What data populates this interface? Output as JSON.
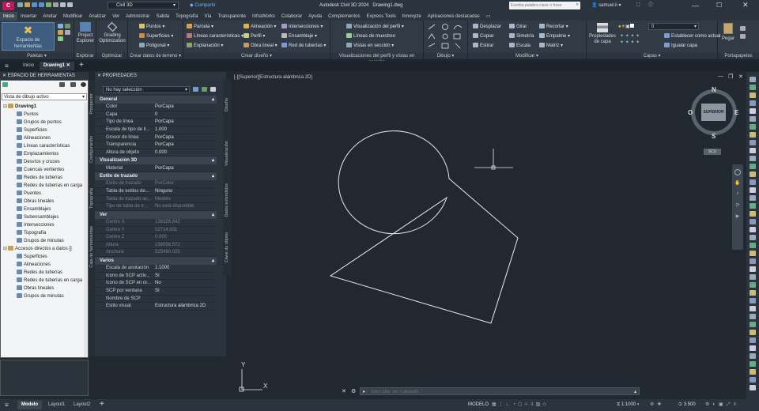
{
  "titlebar": {
    "app_badge": "C",
    "workspace": "Civil 3D",
    "share": "Compartir",
    "title": "Autodesk Civil 3D 2024",
    "file": "Drawing1.dwg",
    "search_placeholder": "Escriba palabra clave o frase",
    "user": "samuel.li"
  },
  "menu": [
    "Inicio",
    "Insertar",
    "Anotar",
    "Modificar",
    "Analizar",
    "Ver",
    "Administrar",
    "Salida",
    "Topografía",
    "Vía",
    "Transparente",
    "InfraWorks",
    "Colaborar",
    "Ayuda",
    "Complementos",
    "Express Tools",
    "Innovyze",
    "Aplicaciones destacadas"
  ],
  "ribbon": {
    "palettes": {
      "title": "Paletas ▾",
      "btn": "Espacio de herramientas"
    },
    "explorer": {
      "title": "Explorar",
      "btn": "Project Explorer"
    },
    "optimizer": {
      "title": "Optimizar",
      "btn1": "Grading",
      "btn2": "Optimization"
    },
    "ground": {
      "title": "Crear datos de terreno ▾",
      "items": [
        "Puntos ▾",
        "Superficies ▾",
        "Poligonal ▾"
      ]
    },
    "design": {
      "title": "Crear diseño ▾",
      "col1": [
        "Parcela ▾",
        "Líneas características ▾",
        "Explanación ▾"
      ],
      "col2": [
        "Alineación ▾",
        "Perfil ▾",
        "Obra lineal ▾"
      ],
      "col3": [
        "Intersecciones ▾",
        "Ensamblaje ▾",
        "Red de tuberías ▾"
      ]
    },
    "profile": {
      "title": "Visualizaciones del perfil y vistas en sección",
      "items": [
        "Visualización del perfil ▾",
        "Líneas de muestreo",
        "Vistas en sección ▾"
      ]
    },
    "draw": {
      "title": "Dibujo ▾"
    },
    "modify": {
      "title": "Modificar ▾",
      "col1": [
        "Desplazar",
        "Copiar",
        "Estirar"
      ],
      "col2": [
        "Girar",
        "Simetría",
        "Escala"
      ],
      "col3": [
        "Recortar ▾",
        "Empalme ▾",
        "Matriz ▾"
      ]
    },
    "layers": {
      "title": "Capas ▾",
      "btn": "Propiedades de capa",
      "layer_value": "0",
      "set_current": "Establecer como actual",
      "match": "Igualar capa"
    },
    "clipboard": {
      "title": "Portapapeles",
      "btn": "Pegar"
    }
  },
  "file_tabs": [
    "Inicio",
    "Drawing1"
  ],
  "toolspace": {
    "title": "ESPACIO DE HERRAMIENTAS",
    "view": "Vista de dibujo activo",
    "tree": [
      {
        "label": "Drawing1",
        "level": 0,
        "bold": true
      },
      {
        "label": "Puntos",
        "level": 1
      },
      {
        "label": "Grupos de puntos",
        "level": 1
      },
      {
        "label": "Superficies",
        "level": 1
      },
      {
        "label": "Alineaciones",
        "level": 1
      },
      {
        "label": "Líneas características",
        "level": 1
      },
      {
        "label": "Emplazamientos",
        "level": 1
      },
      {
        "label": "Desvíos y cruces",
        "level": 1
      },
      {
        "label": "Cuencas vertientes",
        "level": 1
      },
      {
        "label": "Redes de tuberías",
        "level": 1
      },
      {
        "label": "Redes de tuberías en carga",
        "level": 1
      },
      {
        "label": "Puentes",
        "level": 1
      },
      {
        "label": "Obras lineales",
        "level": 1
      },
      {
        "label": "Ensamblajes",
        "level": 1
      },
      {
        "label": "Subensamblajes",
        "level": 1
      },
      {
        "label": "Intersecciones",
        "level": 1
      },
      {
        "label": "Topografía",
        "level": 1
      },
      {
        "label": "Grupos de minutas",
        "level": 1
      },
      {
        "label": "Accesos directos a datos []",
        "level": 0
      },
      {
        "label": "Superficies",
        "level": 1
      },
      {
        "label": "Alineaciones",
        "level": 1
      },
      {
        "label": "Redes de tuberías",
        "level": 1
      },
      {
        "label": "Redes de tuberías en carga",
        "level": 1
      },
      {
        "label": "Obras lineales",
        "level": 1
      },
      {
        "label": "Grupos de minutas",
        "level": 1
      }
    ],
    "side_tabs": [
      "Prospector",
      "Configuración",
      "Topografía",
      "Caja de herramientas"
    ]
  },
  "properties": {
    "title": "PROPIEDADES",
    "selection": "No hay selección",
    "sections": [
      {
        "name": "General",
        "rows": [
          [
            "Color",
            "PorCapa"
          ],
          [
            "Capa",
            "0"
          ],
          [
            "Tipo de línea",
            "PorCapa"
          ],
          [
            "Escala de tipo de lí...",
            "1.000"
          ],
          [
            "Grosor de línea",
            "PorCapa"
          ],
          [
            "Transparencia",
            "PorCapa"
          ],
          [
            "Altura de objeto",
            "0.000"
          ]
        ]
      },
      {
        "name": "Visualización 3D",
        "rows": [
          [
            "Material",
            "PorCapa"
          ]
        ]
      },
      {
        "name": "Estilo de trazado",
        "rows": [
          [
            "Estilo de trazado",
            "PorColor"
          ],
          [
            "Tabla de estilos de...",
            "Ninguno"
          ],
          [
            "Tabla de trazado as...",
            "Modelo"
          ],
          [
            "Tipo de tabla de tr...",
            "No está disponible"
          ]
        ]
      },
      {
        "name": "Ver",
        "rows": [
          [
            "Centro X",
            "138326.842"
          ],
          [
            "Centro Y",
            "52714.931"
          ],
          [
            "Centro Z",
            "0.000"
          ],
          [
            "Altura",
            "238056.572"
          ],
          [
            "Anchura",
            "525490.025"
          ]
        ]
      },
      {
        "name": "Varios",
        "rows": [
          [
            "Escala de anotación",
            "1:1000"
          ],
          [
            "Icono de SCP activ...",
            "Sí"
          ],
          [
            "Icono de SCP en or...",
            "No"
          ],
          [
            "SCP por ventana",
            "Sí"
          ],
          [
            "Nombre de SCP",
            ""
          ],
          [
            "Estilo visual",
            "Estructura alámbrica 2D"
          ]
        ]
      }
    ],
    "side_tabs": [
      "Diseño",
      "Visualización",
      "Datos extendidos",
      "Clave de objeto"
    ]
  },
  "viewport": {
    "label": "[-][Superior][Estructura alámbrica 2D]",
    "viewcube": {
      "n": "N",
      "s": "S",
      "e": "E",
      "o": "O",
      "face": "SUPERIOR",
      "wcs": "SCU"
    },
    "ucs_x": "X",
    "ucs_y": "Y"
  },
  "command": {
    "placeholder": "Escriba un comando"
  },
  "status": {
    "tabs": [
      "Modelo",
      "Layout1",
      "Layout2"
    ],
    "mode": "MODELO",
    "scale": "1:1000",
    "value": "3.500"
  }
}
